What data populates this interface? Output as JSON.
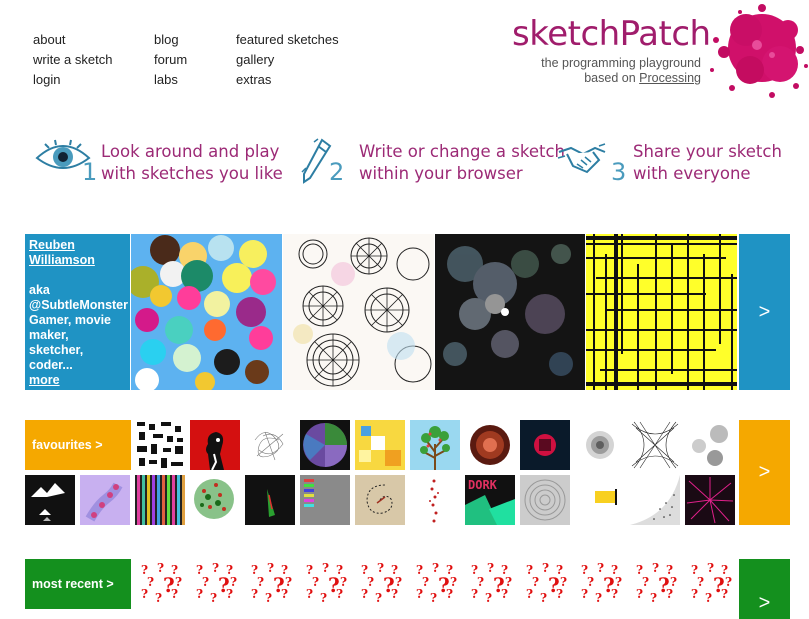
{
  "nav": {
    "about": "about",
    "write": "write a sketch",
    "login": "login",
    "blog": "blog",
    "forum": "forum",
    "labs": "labs",
    "featured": "featured sketches",
    "gallery": "gallery",
    "extras": "extras"
  },
  "logo": {
    "title": "sketchPatch",
    "tagline": "the programming playground",
    "based_on": "based on",
    "processing": "Processing"
  },
  "steps": [
    {
      "num": "1",
      "line1": "Look around and play",
      "line2": "with sketches you like",
      "icon": "eye-icon"
    },
    {
      "num": "2",
      "line1": "Write or change a sketch",
      "line2": "within your browser",
      "icon": "pen-icon"
    },
    {
      "num": "3",
      "line1": "Share your sketch",
      "line2": "with everyone",
      "icon": "handshake-icon"
    }
  ],
  "featured": {
    "author_name": "Reuben Williamson",
    "bio": "aka @SubtleMonster Gamer, movie maker, sketcher, coder...",
    "more": "more",
    "arrow": ">"
  },
  "favourites": {
    "label": "favourites >",
    "arrow": ">"
  },
  "recent": {
    "label": "most recent >",
    "arrow": ">",
    "placeholder": "?"
  },
  "colors": {
    "brand": "#a01d6c",
    "blue": "#1f93c4",
    "orange": "#f5a800",
    "green": "#14901e",
    "step_text": "#9c2a76",
    "step_num": "#4a9bbd"
  }
}
